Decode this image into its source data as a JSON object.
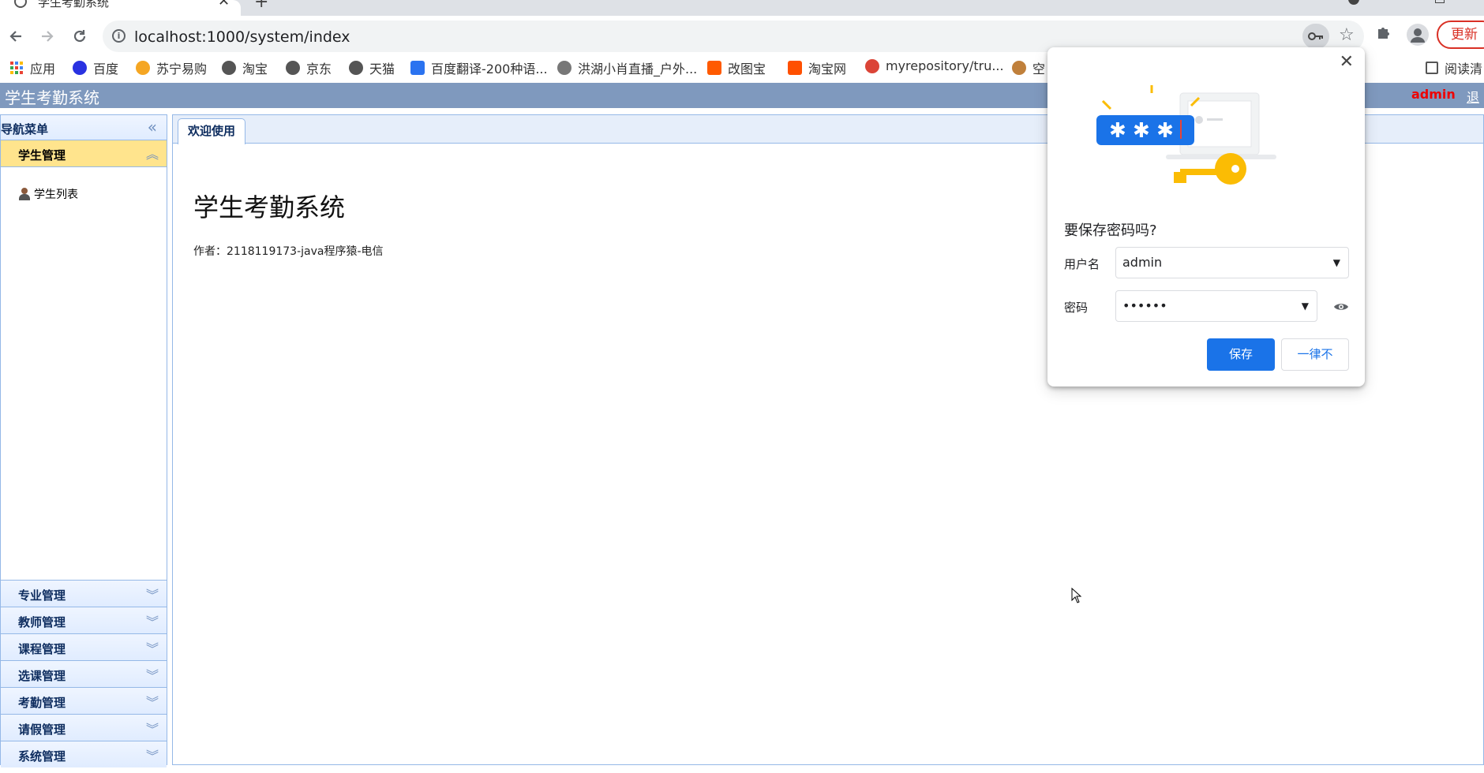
{
  "browser": {
    "tab_title": "学生考勤系统",
    "url": "localhost:1000/system/index",
    "update_label": "更新",
    "bookmarks": [
      {
        "label": "应用",
        "icon": "apps-grid-icon",
        "color": "#ea4335"
      },
      {
        "label": "百度",
        "icon": "baidu-paw-icon",
        "color": "#2932e1"
      },
      {
        "label": "苏宁易购",
        "icon": "suning-icon",
        "color": "#f5a623"
      },
      {
        "label": "淘宝",
        "icon": "globe-icon",
        "color": "#555555"
      },
      {
        "label": "京东",
        "icon": "globe-icon",
        "color": "#555555"
      },
      {
        "label": "天猫",
        "icon": "globe-icon",
        "color": "#555555"
      },
      {
        "label": "百度翻译-200种语...",
        "icon": "baidu-translate-icon",
        "color": "#2b73f0"
      },
      {
        "label": "洪湖小肖直播_户外...",
        "icon": "live-icon",
        "color": "#777777"
      },
      {
        "label": "改图宝",
        "icon": "gaitubao-icon",
        "color": "#ff5a00"
      },
      {
        "label": "淘宝网",
        "icon": "taobao-icon",
        "color": "#ff5000"
      },
      {
        "label": "myrepository/tru...",
        "icon": "chrome-like-icon",
        "color": "#db4437"
      },
      {
        "label": "空",
        "icon": "bookmark-icon",
        "color": "#c0803b"
      }
    ],
    "reading_list": "阅读清"
  },
  "app": {
    "title": "学生考勤系统",
    "user": "admin",
    "logout": "退出",
    "nav_title": "导航菜单",
    "open_section": "学生管理",
    "open_section_items": [
      "学生列表"
    ],
    "sections": [
      "专业管理",
      "教师管理",
      "课程管理",
      "选课管理",
      "考勤管理",
      "请假管理",
      "系统管理"
    ],
    "tab": "欢迎使用",
    "welcome_heading": "学生考勤系统",
    "author": "作者：2118119173-java程序猿-电信"
  },
  "password_dialog": {
    "title": "要保存密码吗?",
    "username_label": "用户名",
    "username_value": "admin",
    "password_label": "密码",
    "password_value": "••••••",
    "save_label": "保存",
    "never_label": "一律不",
    "accent_color": "#1a73e8"
  }
}
